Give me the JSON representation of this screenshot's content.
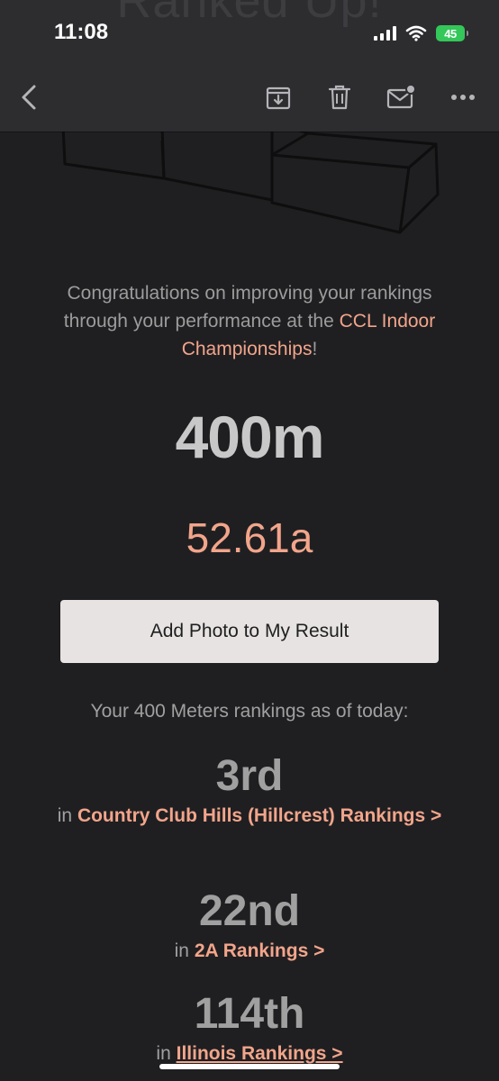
{
  "status_bar": {
    "time": "11:08",
    "battery": "45"
  },
  "header": {
    "ghost_title": "Ranked Up!",
    "icons": [
      "back-icon",
      "archive-icon",
      "trash-icon",
      "mark-unread-icon",
      "more-icon"
    ]
  },
  "email": {
    "message_before": "Congratulations on improving your rankings through your performance at the ",
    "meet_link": "CCL Indoor Championships",
    "message_after": "!",
    "event": "400m",
    "result": "52.61a",
    "add_photo_button": "Add Photo to My Result",
    "rankings_intro": "Your 400 Meters rankings as of today:",
    "rankings": [
      {
        "place": "3rd",
        "prefix": "in ",
        "label": "Country Club Hills (Hillcrest) Rankings >"
      },
      {
        "place": "22nd",
        "prefix": "in ",
        "label": "2A Rankings >"
      },
      {
        "place": "114th",
        "prefix": "in ",
        "label": "Illinois Rankings >"
      }
    ]
  },
  "colors": {
    "background": "#1f1f22",
    "toolbar": "#2d2d30",
    "accent": "#f2a58a",
    "button_bg": "#e7e3e2",
    "battery_green": "#34c759"
  }
}
